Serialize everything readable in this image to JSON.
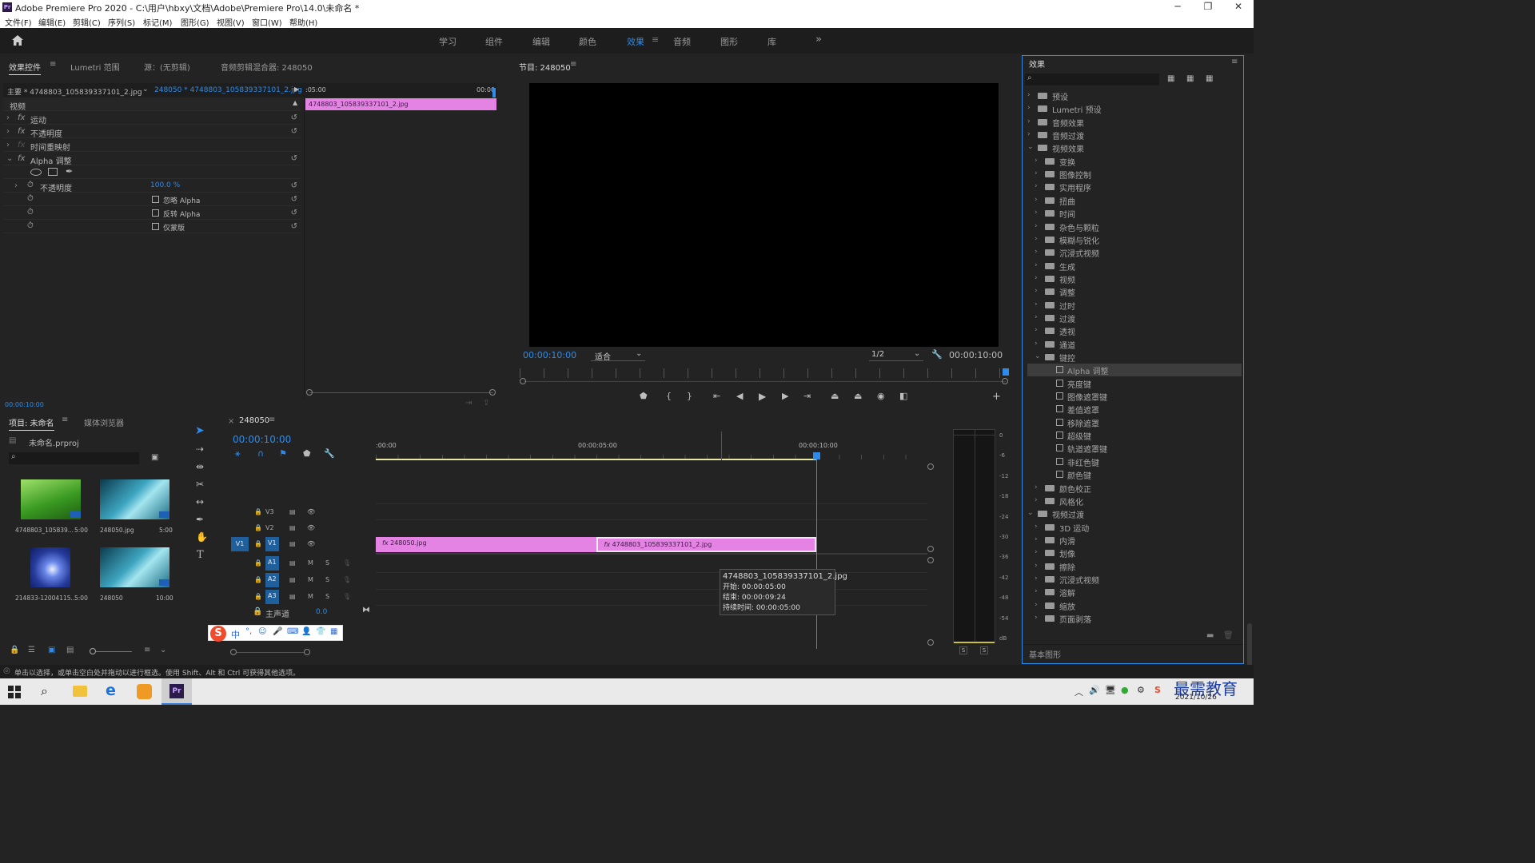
{
  "window": {
    "title": "Adobe Premiere Pro 2020 - C:\\用户\\hbxy\\文档\\Adobe\\Premiere Pro\\14.0\\未命名 *",
    "logo": "Pr"
  },
  "menu": [
    "文件(F)",
    "编辑(E)",
    "剪辑(C)",
    "序列(S)",
    "标记(M)",
    "图形(G)",
    "视图(V)",
    "窗口(W)",
    "帮助(H)"
  ],
  "workspaces": [
    "学习",
    "组件",
    "编辑",
    "颜色",
    "效果",
    "音频",
    "图形",
    "库"
  ],
  "active_workspace": "效果",
  "effect_controls": {
    "tabs": [
      "效果控件",
      "Lumetri 范围",
      "源：(无剪辑)",
      "音频剪辑混合器: 248050"
    ],
    "master": "主要 * 4748803_105839337101_2.jpg",
    "seq_clip": "248050 * 4748803_105839337101_2.jpg",
    "ruler": [
      ":05:00",
      "00:00"
    ],
    "clip_name": "4748803_105839337101_2.jpg",
    "section": "视频",
    "rows": [
      {
        "fx": "fx",
        "label": "运动"
      },
      {
        "fx": "fx",
        "label": "不透明度"
      },
      {
        "fx": "fx",
        "label": "时间重映射"
      },
      {
        "fx": "fx",
        "label": "Alpha 调整"
      }
    ],
    "opacity_label": "不透明度",
    "opacity_value": "100.0 %",
    "checkboxes": [
      "忽略 Alpha",
      "反转 Alpha",
      "仅蒙版"
    ],
    "timecode": "00:00:10:00"
  },
  "program": {
    "title": "节目: 248050",
    "timecode_left": "00:00:10:00",
    "fit": "适合",
    "quality": "1/2",
    "timecode_right": "00:00:10:00"
  },
  "effects": {
    "title": "效果",
    "search_placeholder": "",
    "tree": [
      {
        "d": 0,
        "t": "folder",
        "open": false,
        "label": "预设"
      },
      {
        "d": 0,
        "t": "folder",
        "open": false,
        "label": "Lumetri 预设"
      },
      {
        "d": 0,
        "t": "folder",
        "open": false,
        "label": "音频效果"
      },
      {
        "d": 0,
        "t": "folder",
        "open": false,
        "label": "音频过渡"
      },
      {
        "d": 0,
        "t": "folder",
        "open": true,
        "label": "视频效果"
      },
      {
        "d": 1,
        "t": "folder",
        "open": false,
        "label": "变换"
      },
      {
        "d": 1,
        "t": "folder",
        "open": false,
        "label": "图像控制"
      },
      {
        "d": 1,
        "t": "folder",
        "open": false,
        "label": "实用程序"
      },
      {
        "d": 1,
        "t": "folder",
        "open": false,
        "label": "扭曲"
      },
      {
        "d": 1,
        "t": "folder",
        "open": false,
        "label": "时间"
      },
      {
        "d": 1,
        "t": "folder",
        "open": false,
        "label": "杂色与颗粒"
      },
      {
        "d": 1,
        "t": "folder",
        "open": false,
        "label": "模糊与锐化"
      },
      {
        "d": 1,
        "t": "folder",
        "open": false,
        "label": "沉浸式视频"
      },
      {
        "d": 1,
        "t": "folder",
        "open": false,
        "label": "生成"
      },
      {
        "d": 1,
        "t": "folder",
        "open": false,
        "label": "视频"
      },
      {
        "d": 1,
        "t": "folder",
        "open": false,
        "label": "调整"
      },
      {
        "d": 1,
        "t": "folder",
        "open": false,
        "label": "过时"
      },
      {
        "d": 1,
        "t": "folder",
        "open": false,
        "label": "过渡"
      },
      {
        "d": 1,
        "t": "folder",
        "open": false,
        "label": "透视"
      },
      {
        "d": 1,
        "t": "folder",
        "open": false,
        "label": "通道"
      },
      {
        "d": 1,
        "t": "folder",
        "open": true,
        "label": "键控"
      },
      {
        "d": 2,
        "t": "preset",
        "label": "Alpha 调整",
        "sel": true
      },
      {
        "d": 2,
        "t": "preset",
        "label": "亮度键"
      },
      {
        "d": 2,
        "t": "preset",
        "label": "图像遮罩键"
      },
      {
        "d": 2,
        "t": "preset",
        "label": "差值遮罩"
      },
      {
        "d": 2,
        "t": "preset",
        "label": "移除遮罩"
      },
      {
        "d": 2,
        "t": "preset",
        "label": "超级键"
      },
      {
        "d": 2,
        "t": "preset",
        "label": "轨道遮罩键"
      },
      {
        "d": 2,
        "t": "preset",
        "label": "非红色键"
      },
      {
        "d": 2,
        "t": "preset",
        "label": "颜色键"
      },
      {
        "d": 1,
        "t": "folder",
        "open": false,
        "label": "颜色校正"
      },
      {
        "d": 1,
        "t": "folder",
        "open": false,
        "label": "风格化"
      },
      {
        "d": 0,
        "t": "folder",
        "open": true,
        "label": "视频过渡"
      },
      {
        "d": 1,
        "t": "folder",
        "open": false,
        "label": "3D 运动"
      },
      {
        "d": 1,
        "t": "folder",
        "open": false,
        "label": "内滑"
      },
      {
        "d": 1,
        "t": "folder",
        "open": false,
        "label": "划像"
      },
      {
        "d": 1,
        "t": "folder",
        "open": false,
        "label": "擦除"
      },
      {
        "d": 1,
        "t": "folder",
        "open": false,
        "label": "沉浸式视频"
      },
      {
        "d": 1,
        "t": "folder",
        "open": false,
        "label": "溶解"
      },
      {
        "d": 1,
        "t": "folder",
        "open": false,
        "label": "缩放"
      },
      {
        "d": 1,
        "t": "folder",
        "open": false,
        "label": "页面剥落"
      }
    ],
    "footer_tab": "基本图形"
  },
  "project": {
    "tabs": [
      "项目: 未命名",
      "媒体浏览器"
    ],
    "file": "未命名.prproj",
    "items": [
      {
        "name": "4748803_105839...",
        "dur": "5:00",
        "thumb": "green"
      },
      {
        "name": "248050.jpg",
        "dur": "5:00",
        "thumb": "teal"
      },
      {
        "name": "214833-12004115...",
        "dur": "5:00",
        "thumb": "blue"
      },
      {
        "name": "248050",
        "dur": "10:00",
        "thumb": "teal"
      }
    ]
  },
  "timeline": {
    "tab": "248050",
    "timecode": "00:00:10:00",
    "ruler": [
      ":00:00",
      "00:00:05:00",
      "00:00:10:00"
    ],
    "tracks": [
      "V3",
      "V2",
      "V1",
      "A1",
      "A2",
      "A3"
    ],
    "src_patch": "V1",
    "mute": "M",
    "solo": "S",
    "master_label": "主声道",
    "master_value": "0.0",
    "clips": [
      {
        "name": "248050.jpg",
        "start": 0,
        "end": 5
      },
      {
        "name": "4748803_105839337101_2.jpg",
        "start": 5,
        "end": 10
      }
    ],
    "playhead": 10,
    "tooltip": {
      "name": "4748803_105839337101_2.jpg",
      "start": "开始: 00:00:05:00",
      "end": "结束: 00:00:09:24",
      "duration": "持续时间: 00:00:05:00"
    }
  },
  "meter": {
    "scale": [
      "0",
      "-6",
      "-12",
      "-18",
      "-24",
      "-30",
      "-36",
      "-42",
      "-48",
      "-54",
      "dB"
    ],
    "solo": [
      "S",
      "S"
    ]
  },
  "statusbar": "单击以选择，或单击空白处并拖动以进行框选。使用 Shift、Alt 和 Ctrl 可获得其他选项。",
  "ime": {
    "mode": "中"
  },
  "taskbar": {
    "date": "2021/10/26",
    "watermark": "最需教育"
  },
  "colors": {
    "accent": "#2d8ceb",
    "clip": "#e483e4",
    "panel": "#232323",
    "bg": "#1a1a1a"
  }
}
